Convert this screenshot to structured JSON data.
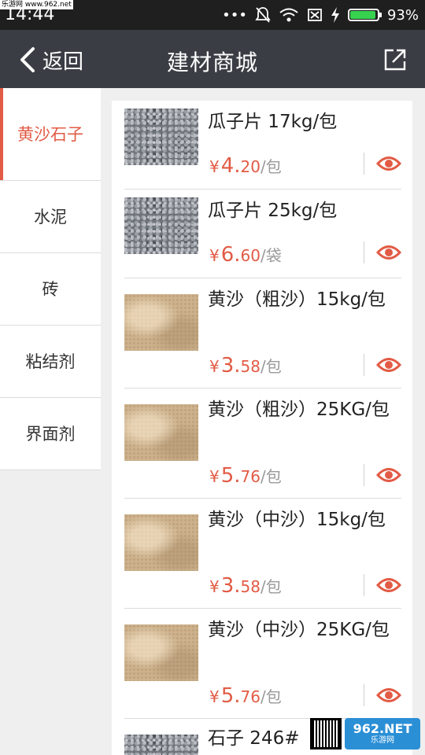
{
  "status_bar": {
    "time": "14:44",
    "watermark": "乐游网 www.962.net",
    "battery_percent": "93%",
    "battery_level": 0.93,
    "icons": [
      "dots-icon",
      "mute-icon",
      "wifi-icon",
      "no-sim-icon",
      "charging-icon",
      "battery-icon"
    ]
  },
  "header": {
    "back_label": "返回",
    "title": "建材商城",
    "share_icon": "share-icon"
  },
  "colors": {
    "accent": "#e25b45",
    "header_bg": "#3a3d44",
    "status_bg": "#1f1f1f"
  },
  "sidebar": {
    "items": [
      {
        "label": "黄沙石子",
        "active": true
      },
      {
        "label": "水泥",
        "active": false
      },
      {
        "label": "砖",
        "active": false
      },
      {
        "label": "粘结剂",
        "active": false
      },
      {
        "label": "界面剂",
        "active": false
      }
    ]
  },
  "products": [
    {
      "name": "瓜子片 17kg/包",
      "currency": "¥",
      "price_int": "4.",
      "price_dec": "20",
      "unit": "/包",
      "image": "gravel"
    },
    {
      "name": "瓜子片 25kg/包",
      "currency": "¥",
      "price_int": "6.",
      "price_dec": "60",
      "unit": "/袋",
      "image": "gravel"
    },
    {
      "name": "黄沙（粗沙）15kg/包",
      "currency": "¥",
      "price_int": "3.",
      "price_dec": "58",
      "unit": "/包",
      "image": "sand"
    },
    {
      "name": "黄沙（粗沙）25KG/包",
      "currency": "¥",
      "price_int": "5.",
      "price_dec": "76",
      "unit": "/包",
      "image": "sand"
    },
    {
      "name": "黄沙（中沙）15kg/包",
      "currency": "¥",
      "price_int": "3.",
      "price_dec": "58",
      "unit": "/包",
      "image": "sand"
    },
    {
      "name": "黄沙（中沙）25KG/包",
      "currency": "¥",
      "price_int": "5.",
      "price_dec": "76",
      "unit": "/包",
      "image": "sand"
    },
    {
      "name": "石子 246#",
      "image": "gravel"
    }
  ],
  "watermark_logo": {
    "top": "962.NET",
    "bottom": "乐游网"
  }
}
